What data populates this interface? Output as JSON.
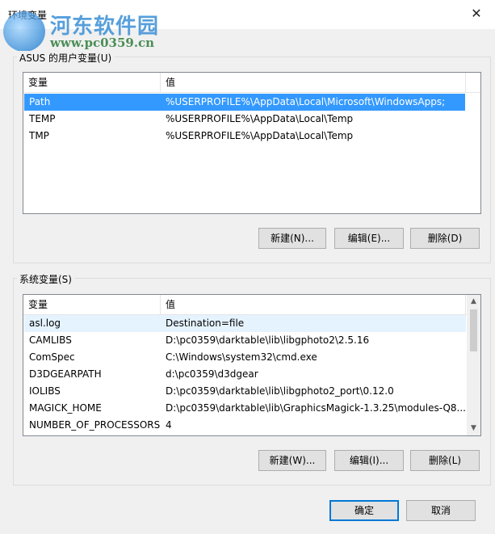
{
  "window": {
    "title": "环境变量",
    "close_symbol": "✕"
  },
  "watermark": {
    "title": "河东软件园",
    "url": "www.pc0359.cn"
  },
  "user_vars": {
    "group_label": "ASUS 的用户变量(U)",
    "col_name": "变量",
    "col_value": "值",
    "rows": [
      {
        "name": "Path",
        "value": "%USERPROFILE%\\AppData\\Local\\Microsoft\\WindowsApps;"
      },
      {
        "name": "TEMP",
        "value": "%USERPROFILE%\\AppData\\Local\\Temp"
      },
      {
        "name": "TMP",
        "value": "%USERPROFILE%\\AppData\\Local\\Temp"
      }
    ],
    "new_label": "新建(N)...",
    "edit_label": "编辑(E)...",
    "delete_label": "删除(D)"
  },
  "system_vars": {
    "group_label": "系统变量(S)",
    "col_name": "变量",
    "col_value": "值",
    "rows": [
      {
        "name": "asl.log",
        "value": "Destination=file"
      },
      {
        "name": "CAMLIBS",
        "value": "D:\\pc0359\\darktable\\lib\\libgphoto2\\2.5.16"
      },
      {
        "name": "ComSpec",
        "value": "C:\\Windows\\system32\\cmd.exe"
      },
      {
        "name": "D3DGEARPATH",
        "value": "d:\\pc0359\\d3dgear"
      },
      {
        "name": "IOLIBS",
        "value": "D:\\pc0359\\darktable\\lib\\libgphoto2_port\\0.12.0"
      },
      {
        "name": "MAGICK_HOME",
        "value": "D:\\pc0359\\darktable\\lib\\GraphicsMagick-1.3.25\\modules-Q8..."
      },
      {
        "name": "NUMBER_OF_PROCESSORS",
        "value": "4"
      }
    ],
    "new_label": "新建(W)...",
    "edit_label": "编辑(I)...",
    "delete_label": "删除(L)"
  },
  "footer": {
    "ok_label": "确定",
    "cancel_label": "取消"
  }
}
